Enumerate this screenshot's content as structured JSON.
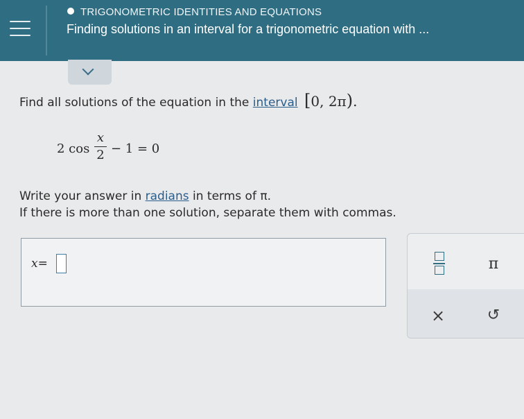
{
  "header": {
    "topic": "TRIGONOMETRIC IDENTITIES AND EQUATIONS",
    "title": "Finding solutions in an interval for a trigonometric equation with ..."
  },
  "question": {
    "prompt": "Find all solutions of the equation in the",
    "interval_link": "interval",
    "interval_open": "[",
    "interval_values": "0, 2π",
    "interval_close": ")",
    "interval_period": ".",
    "equation": {
      "lead": "2 cos",
      "numerator": "x",
      "denominator": "2",
      "tail": "− 1 = 0"
    },
    "instruction_prefix": "Write your answer in",
    "radians_link": "radians",
    "instruction_suffix": "in terms of π.",
    "instruction_line2": "If there is more than one solution, separate them with commas."
  },
  "answer": {
    "variable": "x",
    "equals": "="
  },
  "keypad": {
    "pi_key": "π",
    "clear_key": "×",
    "undo_key": "↺"
  }
}
